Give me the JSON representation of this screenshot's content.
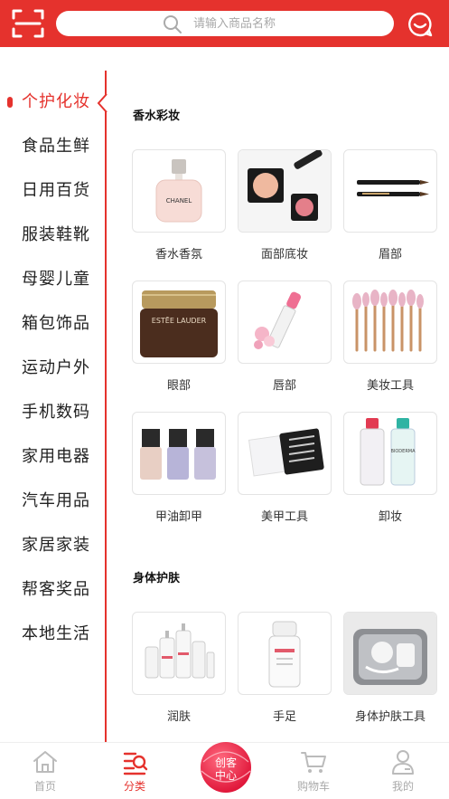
{
  "header": {
    "search_placeholder": "请输入商品名称",
    "scan_icon": "scan-icon",
    "message_icon": "message-icon",
    "color": "#e5322d"
  },
  "sidebar": {
    "active_index": 0,
    "items": [
      {
        "label": "个护化妆"
      },
      {
        "label": "食品生鲜"
      },
      {
        "label": "日用百货"
      },
      {
        "label": "服装鞋靴"
      },
      {
        "label": "母婴儿童"
      },
      {
        "label": "箱包饰品"
      },
      {
        "label": "运动户外"
      },
      {
        "label": "手机数码"
      },
      {
        "label": "家用电器"
      },
      {
        "label": "汽车用品"
      },
      {
        "label": "家居家装"
      },
      {
        "label": "帮客奖品"
      },
      {
        "label": "本地生活"
      }
    ]
  },
  "sections": [
    {
      "title": "香水彩妆",
      "items": [
        {
          "label": "香水香氛",
          "image_text": "CHANEL"
        },
        {
          "label": "面部底妆"
        },
        {
          "label": "眉部"
        },
        {
          "label": "眼部",
          "image_text": "ESTĒE LAUDER"
        },
        {
          "label": "唇部"
        },
        {
          "label": "美妆工具"
        },
        {
          "label": "甲油卸甲"
        },
        {
          "label": "美甲工具"
        },
        {
          "label": "卸妆",
          "image_text": "BIODERMA"
        }
      ]
    },
    {
      "title": "身体护肤",
      "items": [
        {
          "label": "润肤"
        },
        {
          "label": "手足"
        },
        {
          "label": "身体护肤工具"
        }
      ]
    }
  ],
  "bottom_nav": {
    "items": [
      {
        "label": "首页",
        "icon": "home-icon"
      },
      {
        "label": "分类",
        "icon": "category-icon",
        "active": true
      },
      {
        "label": "购物车",
        "icon": "cart-icon"
      },
      {
        "label": "我的",
        "icon": "user-icon"
      }
    ],
    "center": {
      "line1": "创客",
      "line2": "中心"
    }
  }
}
